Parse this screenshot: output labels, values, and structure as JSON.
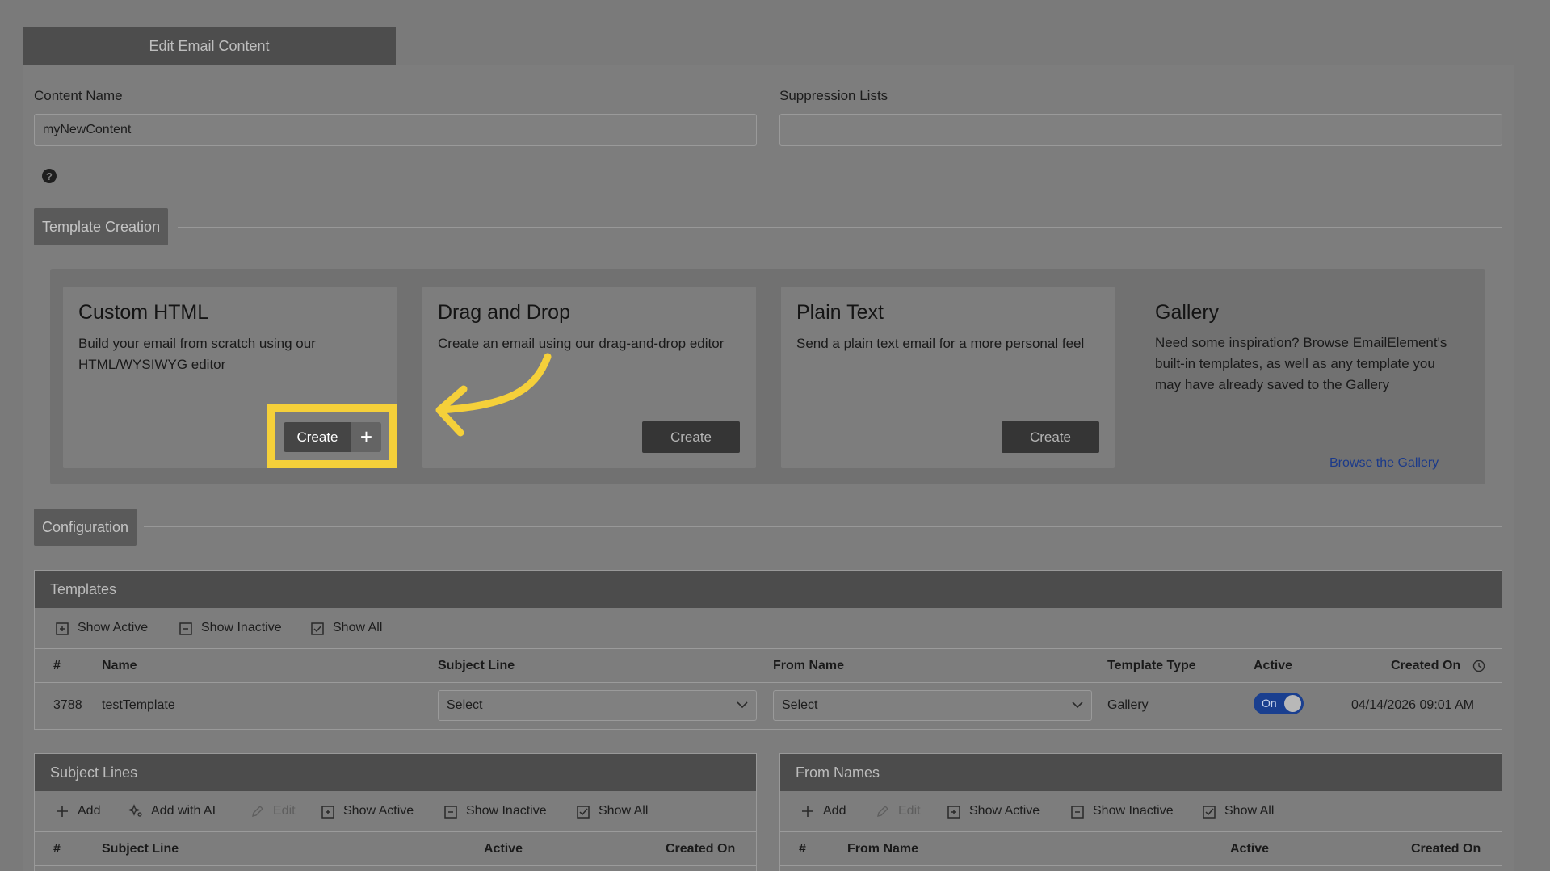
{
  "tab": {
    "label": "Edit Email Content"
  },
  "content_name": {
    "label": "Content Name",
    "value": "myNewContent"
  },
  "suppression_lists": {
    "label": "Suppression Lists",
    "value": ""
  },
  "help": {
    "glyph": "?"
  },
  "template_creation": {
    "heading": "Template Creation",
    "cards": [
      {
        "title": "Custom HTML",
        "desc_line1": "Build your email from scratch using our",
        "desc_line2": "HTML/WYSIWYG editor",
        "button": "Create",
        "plus": "+"
      },
      {
        "title": "Drag and Drop",
        "desc_line1": "Create an email using our drag-and-drop editor",
        "button": "Create"
      },
      {
        "title": "Plain Text",
        "desc_line1": "Send a plain text email for a more personal feel",
        "button": "Create"
      }
    ],
    "gallery": {
      "title": "Gallery",
      "desc_line1": "Need some inspiration? Browse EmailElement's",
      "desc_line2": "built-in templates, as well as any template you",
      "desc_line3": "may have already saved to the Gallery",
      "link": "Browse the Gallery"
    }
  },
  "configuration": {
    "heading": "Configuration"
  },
  "templates": {
    "header": "Templates",
    "toolbar": {
      "show_active": "Show Active",
      "show_inactive": "Show Inactive",
      "show_all": "Show All"
    },
    "columns": {
      "num": "#",
      "name": "Name",
      "subject": "Subject Line",
      "from": "From Name",
      "type": "Template Type",
      "active": "Active",
      "created": "Created On"
    },
    "row": {
      "num": "3788",
      "name": "testTemplate",
      "subject_select": "Select",
      "from_select": "Select",
      "type": "Gallery",
      "active": "On",
      "created": "04/14/2026 09:01 AM"
    }
  },
  "subject_lines": {
    "header": "Subject Lines",
    "toolbar": {
      "add": "Add",
      "add_ai": "Add with AI",
      "edit": "Edit",
      "show_active": "Show Active",
      "show_inactive": "Show Inactive",
      "show_all": "Show All"
    },
    "columns": {
      "num": "#",
      "subject": "Subject Line",
      "active": "Active",
      "created": "Created On"
    }
  },
  "from_names": {
    "header": "From Names",
    "toolbar": {
      "add": "Add",
      "edit": "Edit",
      "show_active": "Show Active",
      "show_inactive": "Show Inactive",
      "show_all": "Show All"
    },
    "columns": {
      "num": "#",
      "from": "From Name",
      "active": "Active",
      "created": "Created On"
    }
  },
  "colors": {
    "highlight": "#f5d03a",
    "arrow": "#f5d03a",
    "toggle_on": "#1a3f8f",
    "link": "#1b3a8a"
  }
}
